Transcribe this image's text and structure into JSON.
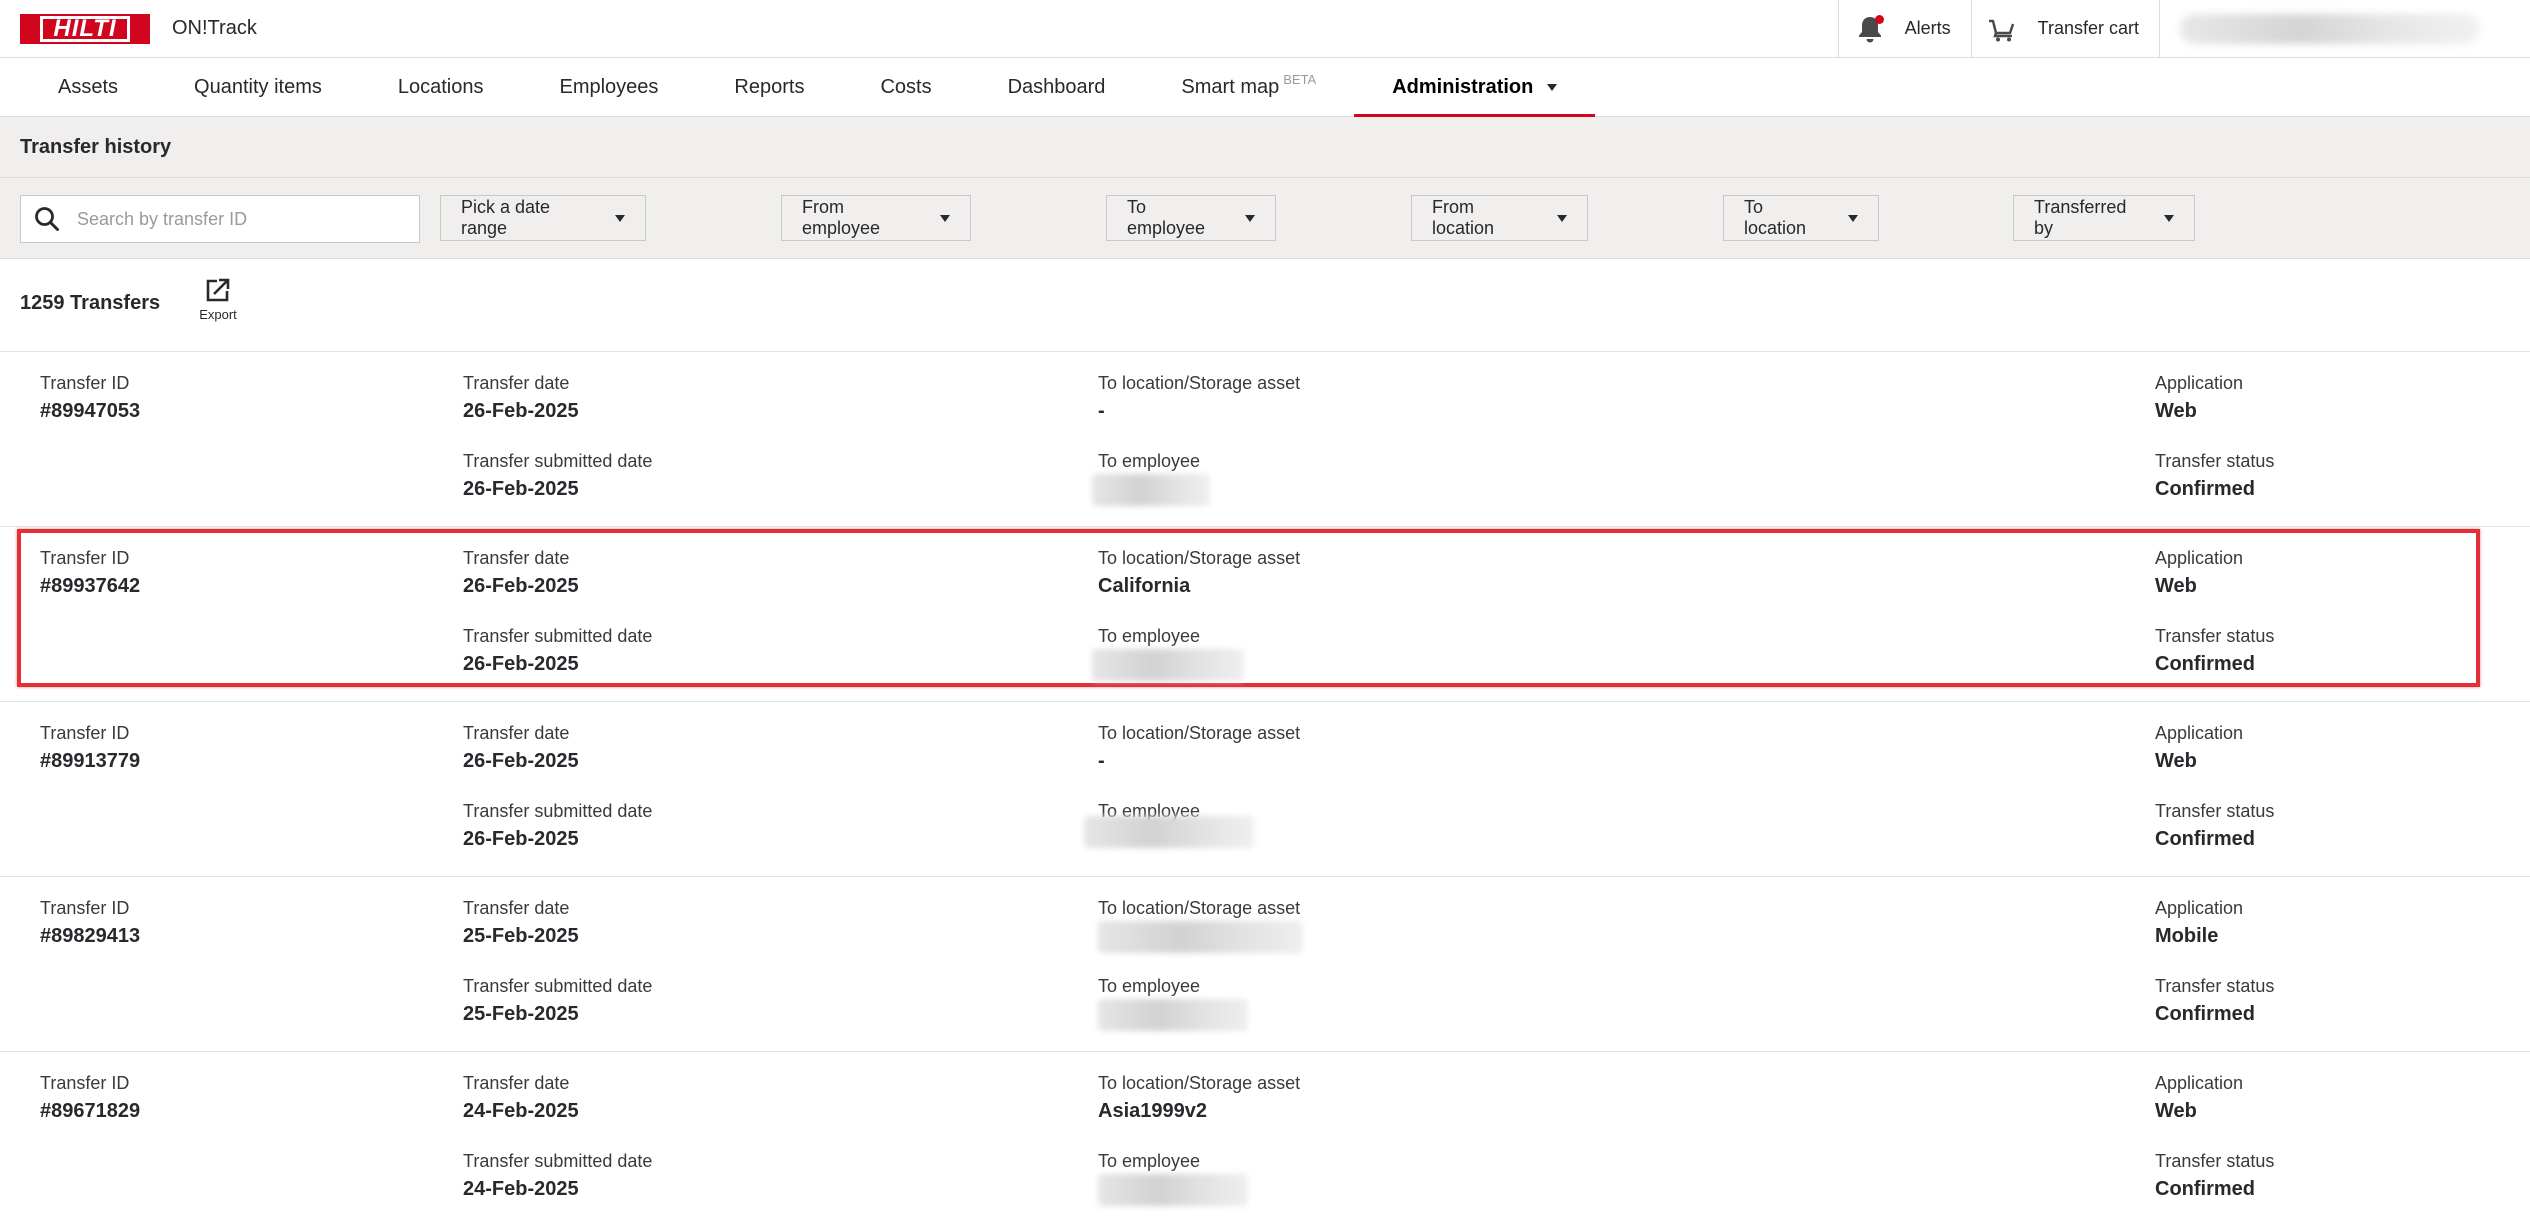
{
  "header": {
    "brand": "HILTI",
    "app_name": "ON!Track",
    "alerts_label": "Alerts",
    "cart_label": "Transfer cart"
  },
  "nav": {
    "items": [
      {
        "label": "Assets"
      },
      {
        "label": "Quantity items"
      },
      {
        "label": "Locations"
      },
      {
        "label": "Employees"
      },
      {
        "label": "Reports"
      },
      {
        "label": "Costs"
      },
      {
        "label": "Dashboard"
      },
      {
        "label": "Smart map",
        "badge": "BETA"
      },
      {
        "label": "Administration",
        "active": true
      }
    ]
  },
  "page": {
    "title": "Transfer history"
  },
  "filters": {
    "search_placeholder": "Search by transfer ID",
    "date_range": "Pick a date range",
    "from_employee": "From employee",
    "to_employee": "To employee",
    "from_location": "From location",
    "to_location": "To location",
    "transferred_by": "Transferred by"
  },
  "summary": {
    "count_label": "1259 Transfers",
    "export_label": "Export"
  },
  "labels": {
    "transfer_id": "Transfer ID",
    "transfer_date": "Transfer date",
    "submitted_date": "Transfer submitted date",
    "to_location": "To location/Storage asset",
    "to_employee": "To employee",
    "application": "Application",
    "status": "Transfer status"
  },
  "transfers": [
    {
      "id": "#89947053",
      "date": "26-Feb-2025",
      "submitted": "26-Feb-2025",
      "to_location": "-",
      "application": "Web",
      "status": "Confirmed"
    },
    {
      "id": "#89937642",
      "date": "26-Feb-2025",
      "submitted": "26-Feb-2025",
      "to_location": "California",
      "application": "Web",
      "status": "Confirmed"
    },
    {
      "id": "#89913779",
      "date": "26-Feb-2025",
      "submitted": "26-Feb-2025",
      "to_location": "-",
      "application": "Web",
      "status": "Confirmed"
    },
    {
      "id": "#89829413",
      "date": "25-Feb-2025",
      "submitted": "25-Feb-2025",
      "to_location": "",
      "application": "Mobile",
      "status": "Confirmed"
    },
    {
      "id": "#89671829",
      "date": "24-Feb-2025",
      "submitted": "24-Feb-2025",
      "to_location": "Asia1999v2",
      "application": "Web",
      "status": "Confirmed"
    }
  ],
  "colors": {
    "brand_red": "#d2051e",
    "highlight_border": "#e0303a",
    "toolbar_bg": "#f0efed"
  }
}
